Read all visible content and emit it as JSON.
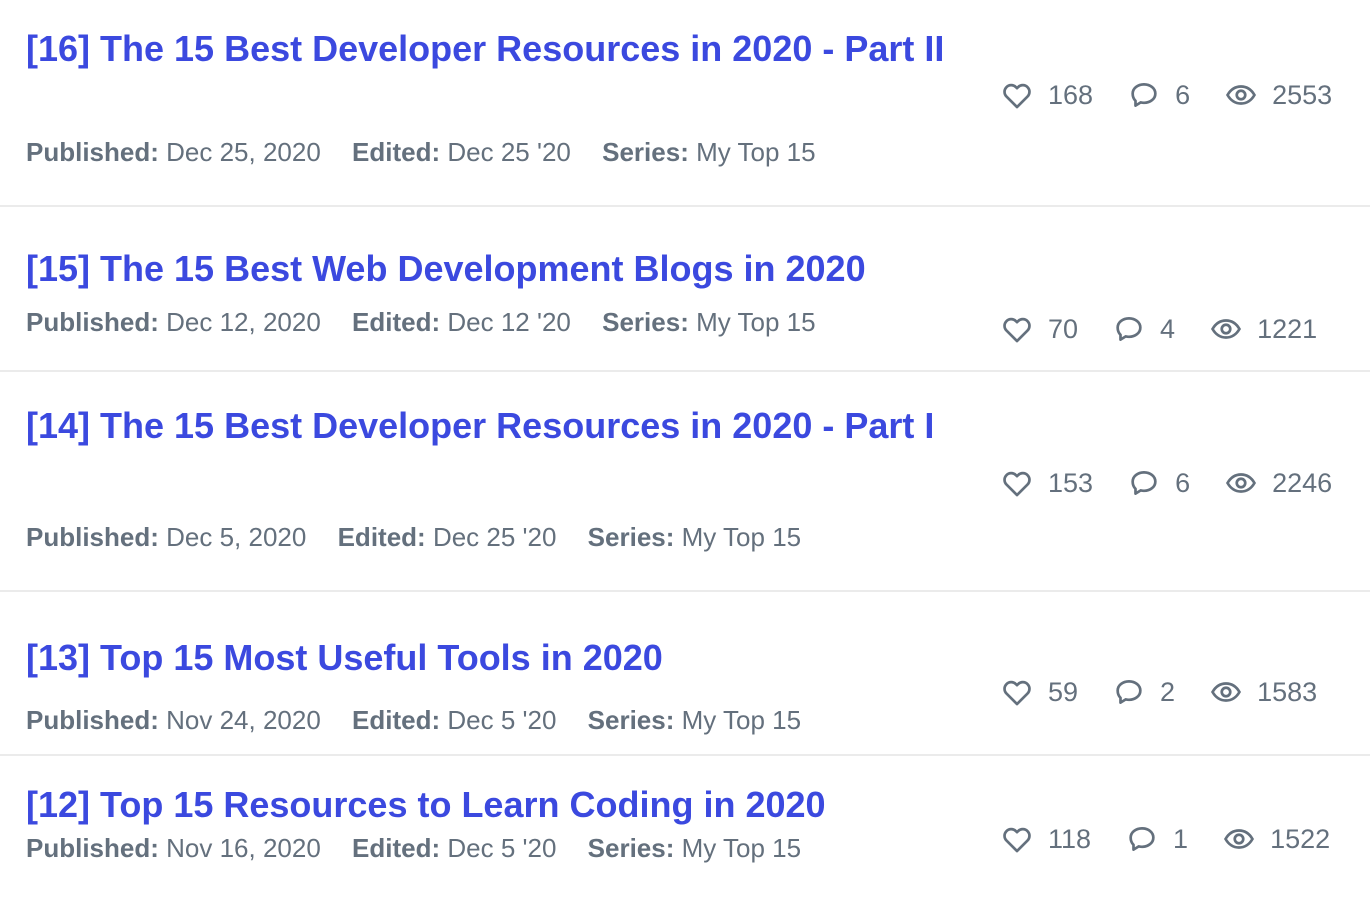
{
  "labels": {
    "published": "Published:",
    "edited": "Edited:",
    "series": "Series:"
  },
  "icons": {
    "likes": "heart-icon",
    "comments": "comment-bubble-icon",
    "views": "eye-icon"
  },
  "colors": {
    "title": "#3b49df",
    "meta": "#64707d",
    "divider": "#ebebeb"
  },
  "posts": [
    {
      "title": "[16] The 15 Best Developer Resources in 2020 - Part II",
      "published": "Dec 25, 2020",
      "edited": "Dec 25 '20",
      "series": "My Top 15",
      "likes": "168",
      "comments": "6",
      "views": "2553"
    },
    {
      "title": "[15] The 15 Best Web Development Blogs in 2020",
      "published": "Dec 12, 2020",
      "edited": "Dec 12 '20",
      "series": "My Top 15",
      "likes": "70",
      "comments": "4",
      "views": "1221"
    },
    {
      "title": "[14] The 15 Best Developer Resources in 2020 - Part I",
      "published": "Dec 5, 2020",
      "edited": "Dec 25 '20",
      "series": "My Top 15",
      "likes": "153",
      "comments": "6",
      "views": "2246"
    },
    {
      "title": "[13] Top 15 Most Useful Tools in 2020",
      "published": "Nov 24, 2020",
      "edited": "Dec 5 '20",
      "series": "My Top 15",
      "likes": "59",
      "comments": "2",
      "views": "1583"
    },
    {
      "title": "[12] Top 15 Resources to Learn Coding in 2020",
      "published": "Nov 16, 2020",
      "edited": "Dec 5 '20",
      "series": "My Top 15",
      "likes": "118",
      "comments": "1",
      "views": "1522"
    }
  ]
}
